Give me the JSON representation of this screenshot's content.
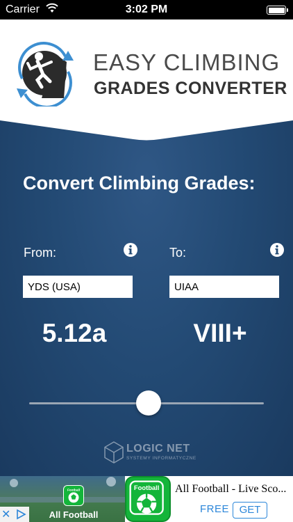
{
  "status_bar": {
    "carrier": "Carrier",
    "time": "3:02 PM"
  },
  "header": {
    "logo_line1": "EASY CLIMBING",
    "logo_line2": "GRADES CONVERTER"
  },
  "converter": {
    "heading": "Convert Climbing Grades:",
    "from_label": "From:",
    "to_label": "To:",
    "from_system": "YDS (USA)",
    "to_system": "UIAA",
    "from_grade": "5.12a",
    "to_grade": "VIII+",
    "slider_position": 0.51
  },
  "footer": {
    "company_name": "LOGIC NET",
    "company_sub": "SYSTEMY INFORMATYCZNE"
  },
  "ad": {
    "left_app_name": "All Football",
    "badge_text": "Football",
    "title": "All Football - Live Sco...",
    "price": "FREE",
    "button_label": "GET"
  },
  "colors": {
    "background": "#234a74",
    "header_bg": "#ffffff",
    "accent_arrow": "#3d8fd1",
    "ad_green": "#14b53a",
    "ad_blue": "#2b86d9"
  },
  "icons": [
    "wifi-icon",
    "battery-icon",
    "climber-logo-icon",
    "info-icon",
    "cube-logo-icon",
    "ad-close-icon",
    "ad-choices-icon"
  ]
}
